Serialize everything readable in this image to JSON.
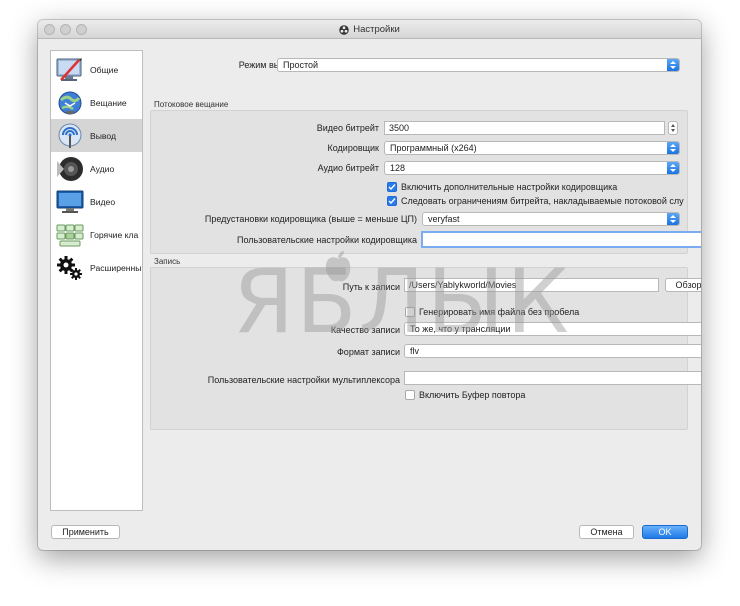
{
  "window": {
    "title": "Настройки"
  },
  "sidebar": {
    "items": [
      {
        "label": "Общие",
        "icon": "monitor-pen-icon"
      },
      {
        "label": "Вещание",
        "icon": "globe-broadcast-icon"
      },
      {
        "label": "Вывод",
        "icon": "broadcast-tower-icon"
      },
      {
        "label": "Аудио",
        "icon": "speaker-icon"
      },
      {
        "label": "Видео",
        "icon": "display-icon"
      },
      {
        "label": "Горячие кла",
        "icon": "keyboard-icon"
      },
      {
        "label": "Расширенны",
        "icon": "gears-icon"
      }
    ],
    "active_index": 2
  },
  "output_mode": {
    "label": "Режим вывода",
    "value": "Простой"
  },
  "streaming": {
    "title": "Потоковое вещание",
    "video_bitrate": {
      "label": "Видео битрейт",
      "value": "3500"
    },
    "encoder": {
      "label": "Кодировщик",
      "value": "Программный (x264)"
    },
    "audio_bitrate": {
      "label": "Аудио битрейт",
      "value": "128"
    },
    "advanced_encoder": {
      "label": "Включить дополнительные настройки кодировщика",
      "checked": true
    },
    "bitrate_limits": {
      "label": "Следовать ограничениям битрейта, накладываемые потоковой слу",
      "checked": true
    },
    "preset": {
      "label": "Предустановки кодировщика (выше = меньше ЦП)",
      "value": "veryfast"
    },
    "custom_encoder": {
      "label": "Пользовательские настройки кодировщика",
      "value": ""
    }
  },
  "recording": {
    "title": "Запись",
    "path": {
      "label": "Путь к записи",
      "value": "/Users/Yablykworld/Movies",
      "browse": "Обзор"
    },
    "no_space": {
      "label": "Генерировать имя файла без пробела",
      "checked": false
    },
    "quality": {
      "label": "Качество записи",
      "value": "То же, что у трансляции"
    },
    "format": {
      "label": "Формат записи",
      "value": "flv"
    },
    "muxer": {
      "label": "Пользовательские настройки мультиплексора",
      "value": ""
    },
    "replay_buffer": {
      "label": "Включить Буфер повтора",
      "checked": false
    }
  },
  "buttons": {
    "apply": "Применить",
    "cancel": "Отмена",
    "ok": "OK"
  },
  "watermark": {
    "text": "ЯБЛЫК"
  },
  "colors": {
    "accent": "#2a7bea",
    "active_item": "#d5d5d5",
    "group_bg": "#e2e2e2"
  }
}
